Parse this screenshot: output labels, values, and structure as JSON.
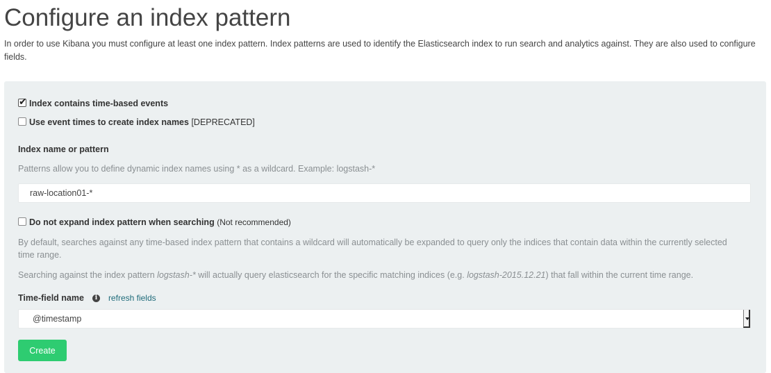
{
  "title": "Configure an index pattern",
  "intro": "In order to use Kibana you must configure at least one index pattern. Index patterns are used to identify the Elasticsearch index to run search and analytics against. They are also used to configure fields.",
  "options": {
    "time_based": {
      "label": "Index contains time-based events",
      "checked": true
    },
    "event_times": {
      "label": "Use event times to create index names",
      "suffix": "[DEPRECATED]",
      "checked": false
    },
    "no_expand": {
      "label": "Do not expand index pattern when searching",
      "suffix": "(Not recommended)",
      "checked": false
    }
  },
  "index_field": {
    "label": "Index name or pattern",
    "help": "Patterns allow you to define dynamic index names using * as a wildcard. Example: logstash-*",
    "value": "raw-location01-*"
  },
  "expand_help": {
    "line1": "By default, searches against any time-based index pattern that contains a wildcard will automatically be expanded to query only the indices that contain data within the currently selected time range.",
    "line2_prefix": "Searching against the index pattern ",
    "line2_pattern": "logstash-*",
    "line2_mid": " will actually query elasticsearch for the specific matching indices (e.g. ",
    "line2_example": "logstash-2015.12.21",
    "line2_suffix": ") that fall within the current time range."
  },
  "time_field": {
    "label": "Time-field name",
    "info_icon": "info-icon",
    "refresh_label": "refresh fields",
    "selected": "@timestamp"
  },
  "create_label": "Create",
  "colors": {
    "panel": "#ecf0f1",
    "create_button": "#2ecc71",
    "link": "#1f6b7a"
  }
}
